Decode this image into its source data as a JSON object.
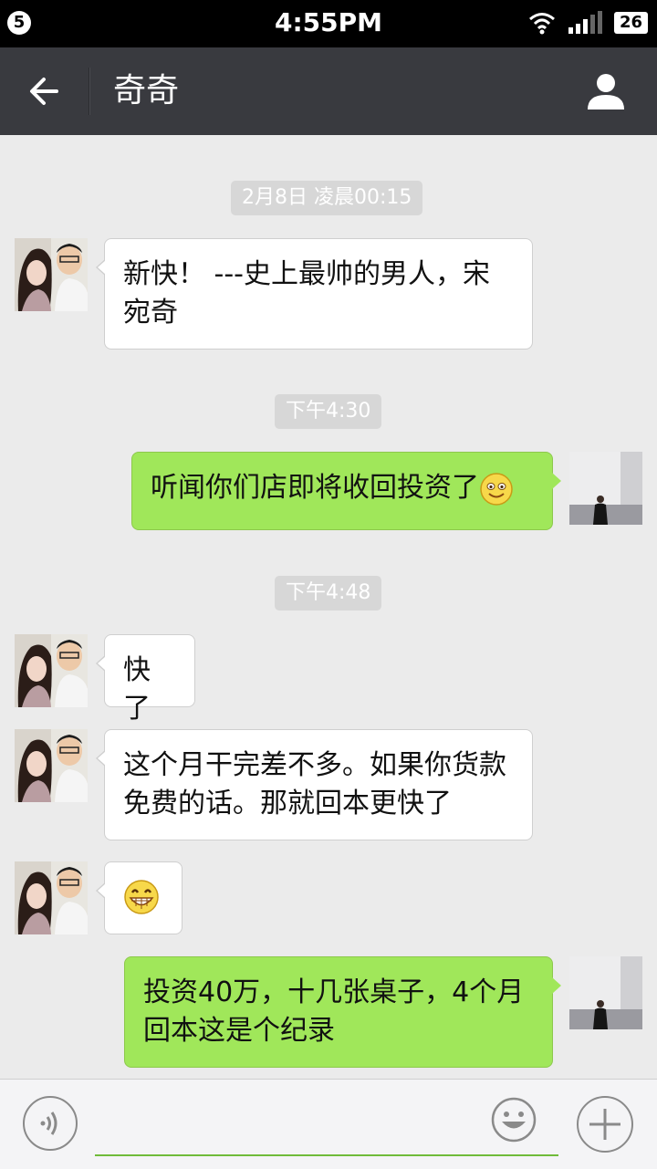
{
  "status_bar": {
    "left_badge": "5",
    "time": "4:55PM",
    "battery": "26"
  },
  "header": {
    "title": "奇奇"
  },
  "chat": {
    "time_labels": [
      "2月8日 凌晨00:15",
      "下午4:30",
      "下午4:48"
    ],
    "messages": [
      {
        "side": "left",
        "text": "新快！ ---史上最帅的男人，宋宛奇"
      },
      {
        "side": "right",
        "text": "听闻你们店即将收回投资了",
        "emoji": "smile-emoji"
      },
      {
        "side": "left",
        "text": "快了"
      },
      {
        "side": "left",
        "text": "这个月干完差不多。如果你货款免费的话。那就回本更快了"
      },
      {
        "side": "left",
        "emoji": "grin-emoji"
      },
      {
        "side": "right",
        "text": "投资40万，十几张桌子，4个月回本这是个纪录"
      }
    ]
  },
  "input_bar": {
    "placeholder": ""
  },
  "colors": {
    "top_bar": "#393a3f",
    "background": "#ebebeb",
    "sent_bubble": "#a0e75a",
    "received_bubble": "#ffffff"
  }
}
